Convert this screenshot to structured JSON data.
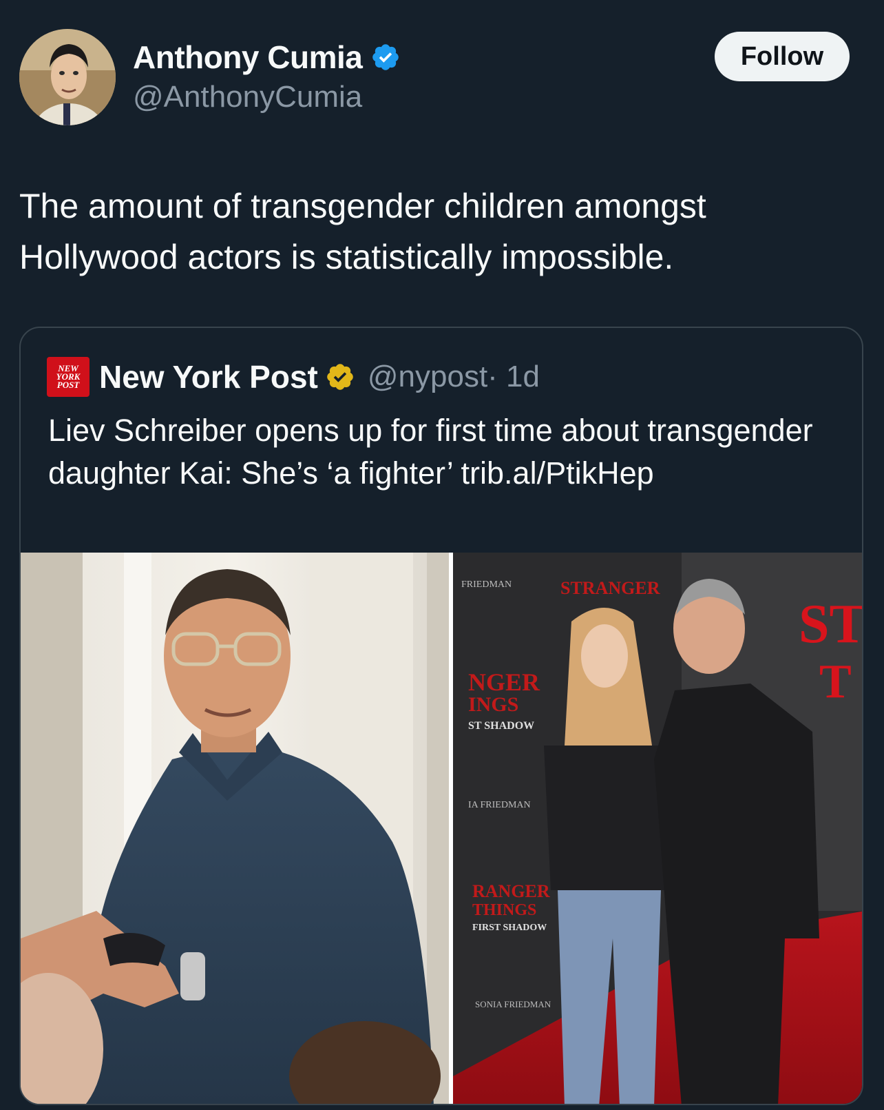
{
  "tweet": {
    "author_name": "Anthony Cumia",
    "author_handle": "@AnthonyCumia",
    "follow_label": "Follow",
    "text": "The amount of transgender children amongst Hollywood actors is statistically impossible."
  },
  "quote": {
    "logo_lines": [
      "NEW",
      "YORK",
      "POST"
    ],
    "author_name": "New York Post",
    "author_handle": "@nypost",
    "time": "· 1d",
    "text": "Liev Schreiber opens up for first time about transgender daughter Kai: She’s ‘a fighter’ trib.al/PtikHep"
  },
  "media": {
    "backdrop_texts": [
      "FRIEDMAN",
      "STRANGER",
      "NGER",
      "INGS",
      "ST SHADOW",
      "IA FRIEDMAN",
      "RANGER",
      "THINGS",
      "FIRST SHADOW",
      "SONIA FRIEDMAN",
      "ST",
      "T"
    ]
  },
  "colors": {
    "background": "#15202b",
    "verified_blue": "#1d9bf0",
    "verified_gold": "#e2b719",
    "nyp_red": "#d0101a"
  },
  "icons": {
    "verified": "verified-badge-icon",
    "org_verified": "gold-verified-badge-icon"
  }
}
